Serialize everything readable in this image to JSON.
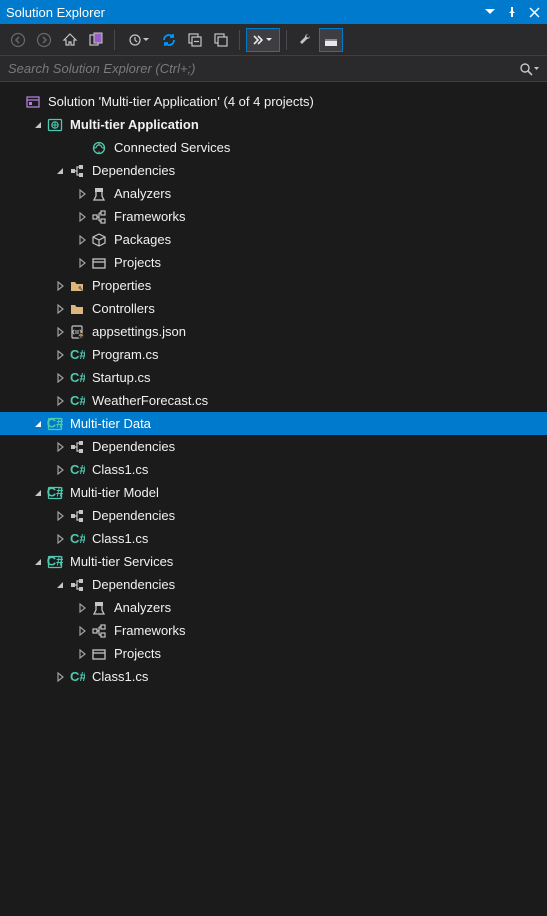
{
  "title": "Solution Explorer",
  "search_placeholder": "Search Solution Explorer (Ctrl+;)",
  "tree": [
    {
      "indent": 0,
      "expand": "none",
      "icon": "solution",
      "label": "Solution 'Multi-tier Application' (4 of 4 projects)",
      "bold": false,
      "selected": false
    },
    {
      "indent": 1,
      "expand": "open",
      "icon": "csproj-web",
      "label": "Multi-tier Application",
      "bold": true,
      "selected": false
    },
    {
      "indent": 3,
      "expand": "none",
      "icon": "connected",
      "label": "Connected Services",
      "bold": false,
      "selected": false
    },
    {
      "indent": 2,
      "expand": "open",
      "icon": "deps",
      "label": "Dependencies",
      "bold": false,
      "selected": false
    },
    {
      "indent": 3,
      "expand": "closed",
      "icon": "analyzers",
      "label": "Analyzers",
      "bold": false,
      "selected": false
    },
    {
      "indent": 3,
      "expand": "closed",
      "icon": "frameworks",
      "label": "Frameworks",
      "bold": false,
      "selected": false
    },
    {
      "indent": 3,
      "expand": "closed",
      "icon": "packages",
      "label": "Packages",
      "bold": false,
      "selected": false
    },
    {
      "indent": 3,
      "expand": "closed",
      "icon": "projects",
      "label": "Projects",
      "bold": false,
      "selected": false
    },
    {
      "indent": 2,
      "expand": "closed",
      "icon": "folder-wrench",
      "label": "Properties",
      "bold": false,
      "selected": false
    },
    {
      "indent": 2,
      "expand": "closed",
      "icon": "folder",
      "label": "Controllers",
      "bold": false,
      "selected": false
    },
    {
      "indent": 2,
      "expand": "closed",
      "icon": "json",
      "label": "appsettings.json",
      "bold": false,
      "selected": false
    },
    {
      "indent": 2,
      "expand": "closed",
      "icon": "cs",
      "label": "Program.cs",
      "bold": false,
      "selected": false
    },
    {
      "indent": 2,
      "expand": "closed",
      "icon": "cs",
      "label": "Startup.cs",
      "bold": false,
      "selected": false
    },
    {
      "indent": 2,
      "expand": "closed",
      "icon": "cs",
      "label": "WeatherForecast.cs",
      "bold": false,
      "selected": false
    },
    {
      "indent": 1,
      "expand": "open",
      "icon": "csproj",
      "label": "Multi-tier Data",
      "bold": false,
      "selected": true
    },
    {
      "indent": 2,
      "expand": "closed",
      "icon": "deps",
      "label": "Dependencies",
      "bold": false,
      "selected": false
    },
    {
      "indent": 2,
      "expand": "closed",
      "icon": "cs",
      "label": "Class1.cs",
      "bold": false,
      "selected": false
    },
    {
      "indent": 1,
      "expand": "open",
      "icon": "csproj",
      "label": "Multi-tier Model",
      "bold": false,
      "selected": false
    },
    {
      "indent": 2,
      "expand": "closed",
      "icon": "deps",
      "label": "Dependencies",
      "bold": false,
      "selected": false
    },
    {
      "indent": 2,
      "expand": "closed",
      "icon": "cs",
      "label": "Class1.cs",
      "bold": false,
      "selected": false
    },
    {
      "indent": 1,
      "expand": "open",
      "icon": "csproj",
      "label": "Multi-tier Services",
      "bold": false,
      "selected": false
    },
    {
      "indent": 2,
      "expand": "open",
      "icon": "deps",
      "label": "Dependencies",
      "bold": false,
      "selected": false
    },
    {
      "indent": 3,
      "expand": "closed",
      "icon": "analyzers",
      "label": "Analyzers",
      "bold": false,
      "selected": false
    },
    {
      "indent": 3,
      "expand": "closed",
      "icon": "frameworks",
      "label": "Frameworks",
      "bold": false,
      "selected": false
    },
    {
      "indent": 3,
      "expand": "closed",
      "icon": "projects",
      "label": "Projects",
      "bold": false,
      "selected": false
    },
    {
      "indent": 2,
      "expand": "closed",
      "icon": "cs",
      "label": "Class1.cs",
      "bold": false,
      "selected": false
    }
  ]
}
